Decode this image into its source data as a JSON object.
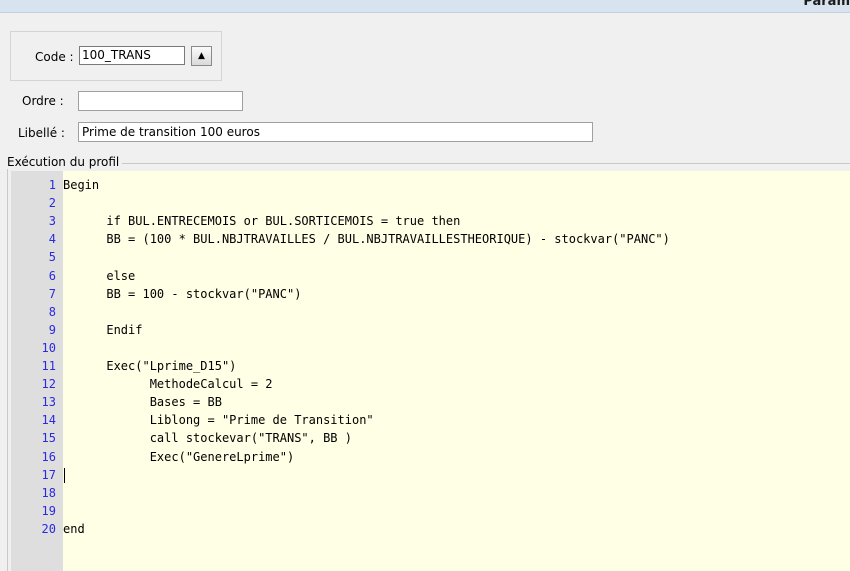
{
  "window": {
    "title": "Param"
  },
  "code_field": {
    "label": "Code :",
    "value": "100_TRANS"
  },
  "ordre_field": {
    "label": "Ordre :",
    "value": ""
  },
  "libelle_field": {
    "label": "Libellé :",
    "value": "Prime de transition 100 euros"
  },
  "profile_section": {
    "legend": "Exécution du profil"
  },
  "editor": {
    "lines": [
      {
        "num": "1",
        "text": "Begin"
      },
      {
        "num": "2",
        "text": ""
      },
      {
        "num": "3",
        "text": "      if BUL.ENTRECEMOIS or BUL.SORTICEMOIS = true then"
      },
      {
        "num": "4",
        "text": "      BB = (100 * BUL.NBJTRAVAILLES / BUL.NBJTRAVAILLESTHEORIQUE) - stockvar(\"PANC\")"
      },
      {
        "num": "5",
        "text": ""
      },
      {
        "num": "6",
        "text": "      else"
      },
      {
        "num": "7",
        "text": "      BB = 100 - stockvar(\"PANC\")"
      },
      {
        "num": "8",
        "text": ""
      },
      {
        "num": "9",
        "text": "      Endif"
      },
      {
        "num": "10",
        "text": ""
      },
      {
        "num": "11",
        "text": "      Exec(\"Lprime_D15\")"
      },
      {
        "num": "12",
        "text": "            MethodeCalcul = 2"
      },
      {
        "num": "13",
        "text": "            Bases = BB"
      },
      {
        "num": "14",
        "text": "            Liblong = \"Prime de Transition\""
      },
      {
        "num": "15",
        "text": "            call stockevar(\"TRANS\", BB )"
      },
      {
        "num": "16",
        "text": "            Exec(\"GenereLprime\")"
      },
      {
        "num": "17",
        "text": ""
      },
      {
        "num": "18",
        "text": ""
      },
      {
        "num": "19",
        "text": ""
      },
      {
        "num": "20",
        "text": "end"
      }
    ]
  }
}
